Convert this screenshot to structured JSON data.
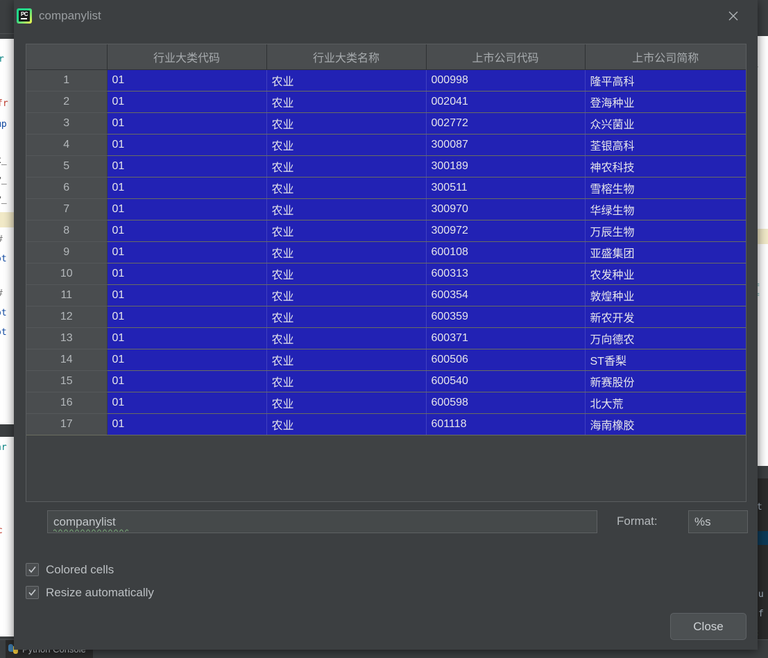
{
  "window": {
    "title": "companylist",
    "app_icon": "pycharm-icon",
    "app_icon_text": "PC",
    "close_icon": "close-icon"
  },
  "table": {
    "index_header": "",
    "columns": [
      "行业大类代码",
      "行业大类名称",
      "上市公司代码",
      "上市公司简称"
    ],
    "rows": [
      {
        "index": "1",
        "c0": "01",
        "c1": "农业",
        "c2": "000998",
        "c3": "隆平高科"
      },
      {
        "index": "2",
        "c0": "01",
        "c1": "农业",
        "c2": "002041",
        "c3": "登海种业"
      },
      {
        "index": "3",
        "c0": "01",
        "c1": "农业",
        "c2": "002772",
        "c3": "众兴菌业"
      },
      {
        "index": "4",
        "c0": "01",
        "c1": "农业",
        "c2": "300087",
        "c3": "荃银高科"
      },
      {
        "index": "5",
        "c0": "01",
        "c1": "农业",
        "c2": "300189",
        "c3": "神农科技"
      },
      {
        "index": "6",
        "c0": "01",
        "c1": "农业",
        "c2": "300511",
        "c3": "雪榕生物"
      },
      {
        "index": "7",
        "c0": "01",
        "c1": "农业",
        "c2": "300970",
        "c3": "华绿生物"
      },
      {
        "index": "8",
        "c0": "01",
        "c1": "农业",
        "c2": "300972",
        "c3": "万辰生物"
      },
      {
        "index": "9",
        "c0": "01",
        "c1": "农业",
        "c2": "600108",
        "c3": "亚盛集团"
      },
      {
        "index": "10",
        "c0": "01",
        "c1": "农业",
        "c2": "600313",
        "c3": "农发种业"
      },
      {
        "index": "11",
        "c0": "01",
        "c1": "农业",
        "c2": "600354",
        "c3": "敦煌种业"
      },
      {
        "index": "12",
        "c0": "01",
        "c1": "农业",
        "c2": "600359",
        "c3": "新农开发"
      },
      {
        "index": "13",
        "c0": "01",
        "c1": "农业",
        "c2": "600371",
        "c3": "万向德农"
      },
      {
        "index": "14",
        "c0": "01",
        "c1": "农业",
        "c2": "600506",
        "c3": "ST香梨"
      },
      {
        "index": "15",
        "c0": "01",
        "c1": "农业",
        "c2": "600540",
        "c3": "新赛股份"
      },
      {
        "index": "16",
        "c0": "01",
        "c1": "农业",
        "c2": "600598",
        "c3": "北大荒"
      },
      {
        "index": "17",
        "c0": "01",
        "c1": "农业",
        "c2": "601118",
        "c3": "海南橡胶"
      }
    ]
  },
  "controls": {
    "name_value": "companylist",
    "name_placeholder": "",
    "format_label": "Format:",
    "format_value": "%s",
    "colored_cells_label": "Colored cells",
    "colored_cells_checked": true,
    "resize_automatically_label": "Resize automatically",
    "resize_automatically_checked": true,
    "close_button": "Close"
  },
  "ide": {
    "status_tab": "Python Console",
    "status_tab_icon": "python-icon"
  },
  "colors": {
    "dialog_bg": "#3c3f41",
    "cell_blue": "#2222b4",
    "header_gray": "#4a4d4f",
    "text_light": "#c3c7ca",
    "grid_line": "#6a6d60"
  }
}
